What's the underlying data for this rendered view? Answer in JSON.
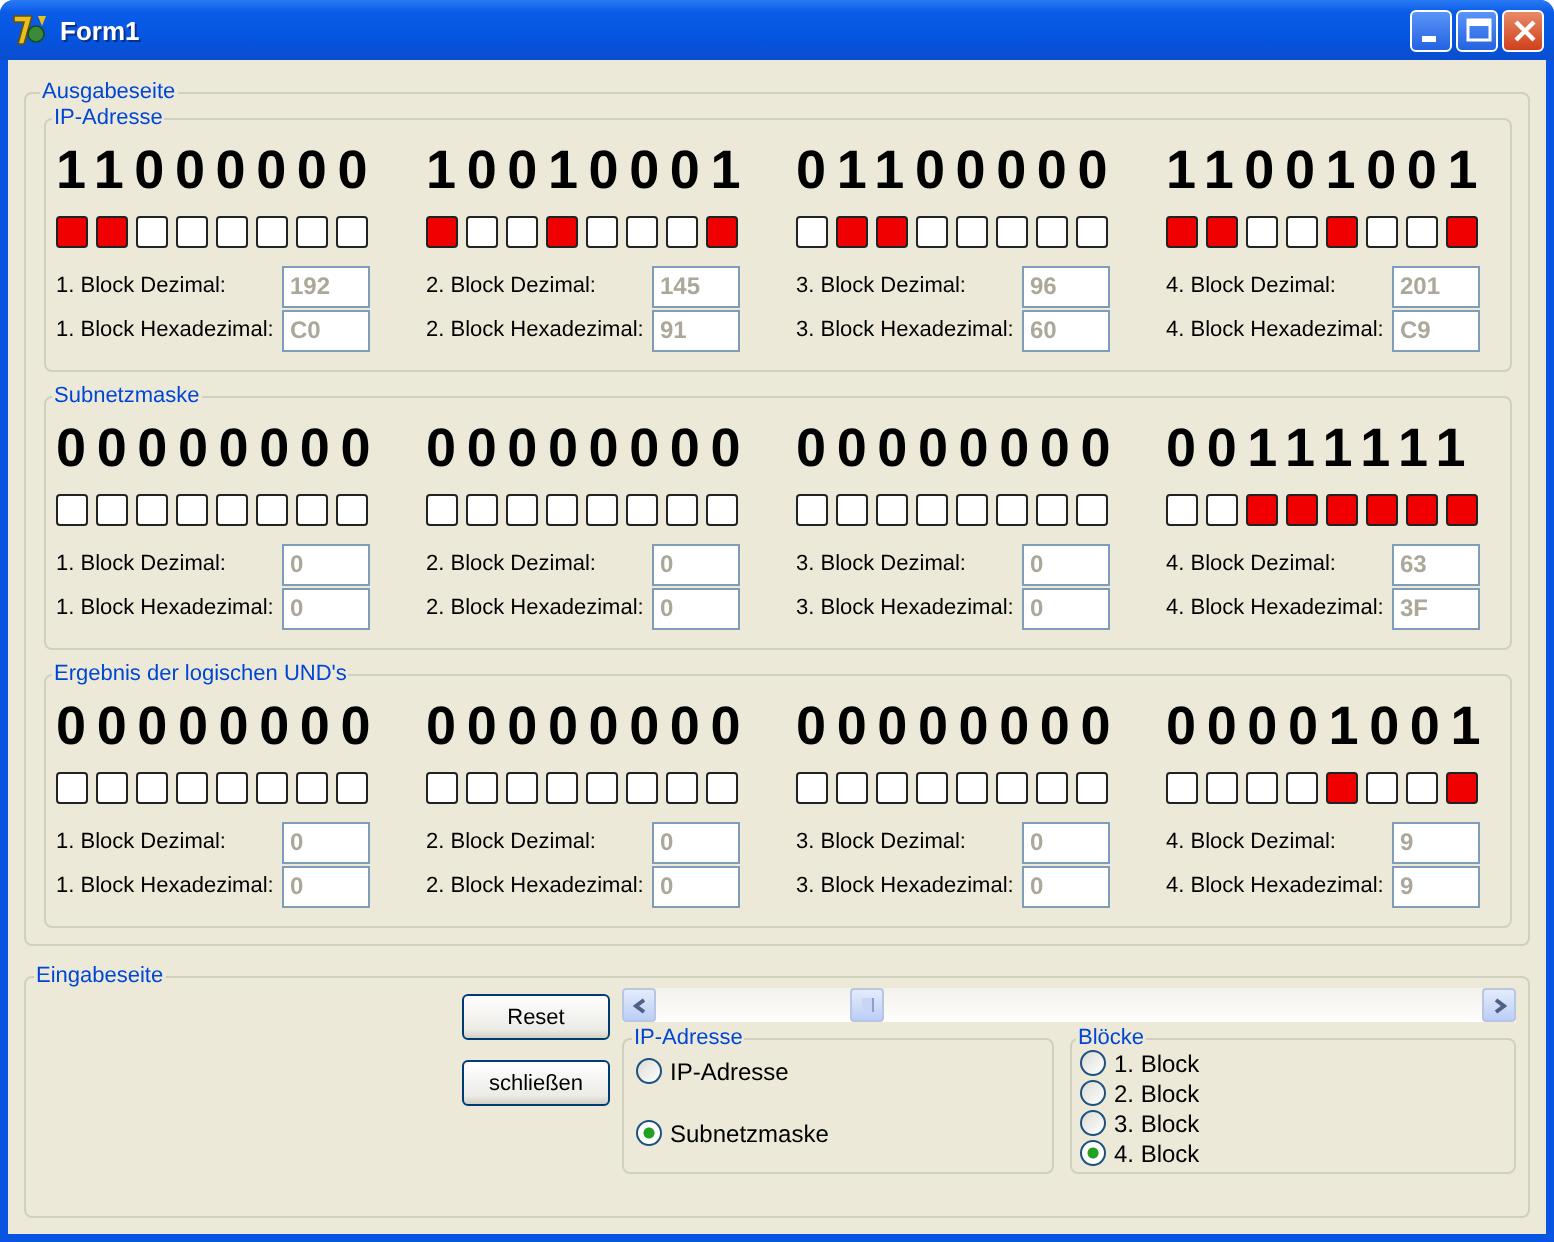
{
  "window": {
    "title": "Form1"
  },
  "output": {
    "title": "Ausgabeseite",
    "groups": [
      {
        "title": "IP-Adresse",
        "blocks": [
          {
            "binary": "11000000",
            "bits": [
              {
                "on": true
              },
              {
                "on": true
              },
              {
                "on": false
              },
              {
                "on": false
              },
              {
                "on": false
              },
              {
                "on": false
              },
              {
                "on": false
              },
              {
                "on": false
              }
            ],
            "decimal_label": "1. Block Dezimal:",
            "decimal": "192",
            "hex_label": "1. Block Hexadezimal:",
            "hex": "C0"
          },
          {
            "binary": "10010001",
            "bits": [
              {
                "on": true
              },
              {
                "on": false
              },
              {
                "on": false
              },
              {
                "on": true
              },
              {
                "on": false
              },
              {
                "on": false
              },
              {
                "on": false
              },
              {
                "on": true
              }
            ],
            "decimal_label": "2. Block Dezimal:",
            "decimal": "145",
            "hex_label": "2. Block Hexadezimal:",
            "hex": "91"
          },
          {
            "binary": "01100000",
            "bits": [
              {
                "on": false
              },
              {
                "on": true
              },
              {
                "on": true
              },
              {
                "on": false
              },
              {
                "on": false
              },
              {
                "on": false
              },
              {
                "on": false
              },
              {
                "on": false
              }
            ],
            "decimal_label": "3. Block Dezimal:",
            "decimal": "96",
            "hex_label": "3. Block Hexadezimal:",
            "hex": "60"
          },
          {
            "binary": "11001001",
            "bits": [
              {
                "on": true
              },
              {
                "on": true
              },
              {
                "on": false
              },
              {
                "on": false
              },
              {
                "on": true
              },
              {
                "on": false
              },
              {
                "on": false
              },
              {
                "on": true
              }
            ],
            "decimal_label": "4. Block Dezimal:",
            "decimal": "201",
            "hex_label": "4. Block Hexadezimal:",
            "hex": "C9"
          }
        ]
      },
      {
        "title": "Subnetzmaske",
        "blocks": [
          {
            "binary": "00000000",
            "bits": [
              {
                "on": false
              },
              {
                "on": false
              },
              {
                "on": false
              },
              {
                "on": false
              },
              {
                "on": false
              },
              {
                "on": false
              },
              {
                "on": false
              },
              {
                "on": false
              }
            ],
            "decimal_label": "1. Block Dezimal:",
            "decimal": "0",
            "hex_label": "1. Block Hexadezimal:",
            "hex": "0"
          },
          {
            "binary": "00000000",
            "bits": [
              {
                "on": false
              },
              {
                "on": false
              },
              {
                "on": false
              },
              {
                "on": false
              },
              {
                "on": false
              },
              {
                "on": false
              },
              {
                "on": false
              },
              {
                "on": false
              }
            ],
            "decimal_label": "2. Block Dezimal:",
            "decimal": "0",
            "hex_label": "2. Block Hexadezimal:",
            "hex": "0"
          },
          {
            "binary": "00000000",
            "bits": [
              {
                "on": false
              },
              {
                "on": false
              },
              {
                "on": false
              },
              {
                "on": false
              },
              {
                "on": false
              },
              {
                "on": false
              },
              {
                "on": false
              },
              {
                "on": false
              }
            ],
            "decimal_label": "3. Block Dezimal:",
            "decimal": "0",
            "hex_label": "3. Block Hexadezimal:",
            "hex": "0"
          },
          {
            "binary": "00111111",
            "bits": [
              {
                "on": false
              },
              {
                "on": false
              },
              {
                "on": true
              },
              {
                "on": true
              },
              {
                "on": true
              },
              {
                "on": true
              },
              {
                "on": true
              },
              {
                "on": true
              }
            ],
            "decimal_label": "4. Block Dezimal:",
            "decimal": "63",
            "hex_label": "4. Block Hexadezimal:",
            "hex": "3F"
          }
        ]
      },
      {
        "title": "Ergebnis der logischen UND's",
        "blocks": [
          {
            "binary": "00000000",
            "bits": [
              {
                "on": false
              },
              {
                "on": false
              },
              {
                "on": false
              },
              {
                "on": false
              },
              {
                "on": false
              },
              {
                "on": false
              },
              {
                "on": false
              },
              {
                "on": false
              }
            ],
            "decimal_label": "1. Block Dezimal:",
            "decimal": "0",
            "hex_label": "1. Block Hexadezimal:",
            "hex": "0"
          },
          {
            "binary": "00000000",
            "bits": [
              {
                "on": false
              },
              {
                "on": false
              },
              {
                "on": false
              },
              {
                "on": false
              },
              {
                "on": false
              },
              {
                "on": false
              },
              {
                "on": false
              },
              {
                "on": false
              }
            ],
            "decimal_label": "2. Block Dezimal:",
            "decimal": "0",
            "hex_label": "2. Block Hexadezimal:",
            "hex": "0"
          },
          {
            "binary": "00000000",
            "bits": [
              {
                "on": false
              },
              {
                "on": false
              },
              {
                "on": false
              },
              {
                "on": false
              },
              {
                "on": false
              },
              {
                "on": false
              },
              {
                "on": false
              },
              {
                "on": false
              }
            ],
            "decimal_label": "3. Block Dezimal:",
            "decimal": "0",
            "hex_label": "3. Block Hexadezimal:",
            "hex": "0"
          },
          {
            "binary": "00001001",
            "bits": [
              {
                "on": false
              },
              {
                "on": false
              },
              {
                "on": false
              },
              {
                "on": false
              },
              {
                "on": true
              },
              {
                "on": false
              },
              {
                "on": false
              },
              {
                "on": true
              }
            ],
            "decimal_label": "4. Block Dezimal:",
            "decimal": "9",
            "hex_label": "4. Block Hexadezimal:",
            "hex": "9"
          }
        ]
      }
    ]
  },
  "input": {
    "title": "Eingabeseite",
    "buttons": [
      "Reset",
      "schließen"
    ],
    "address_group": {
      "title": "IP-Adresse",
      "options": [
        {
          "label": "IP-Adresse",
          "selected": false
        },
        {
          "label": "Subnetzmaske",
          "selected": true
        }
      ]
    },
    "block_group": {
      "title": "Blöcke",
      "options": [
        {
          "label": "1. Block",
          "selected": false
        },
        {
          "label": "2. Block",
          "selected": false
        },
        {
          "label": "3. Block",
          "selected": false
        },
        {
          "label": "4. Block",
          "selected": true
        }
      ]
    }
  }
}
